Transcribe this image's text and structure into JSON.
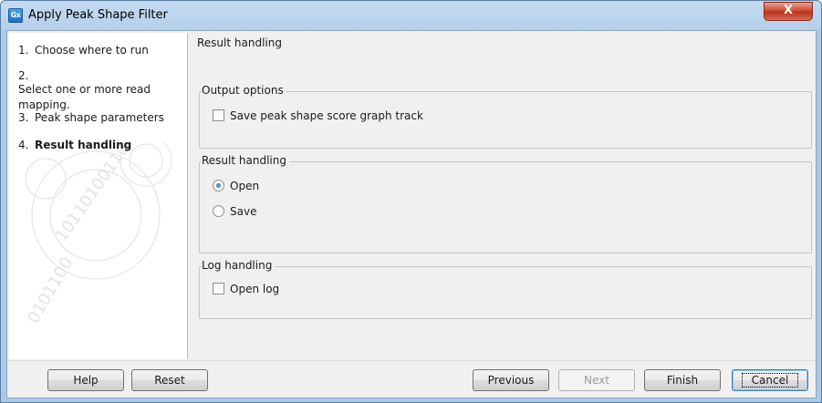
{
  "window": {
    "title": "Apply Peak Shape Filter",
    "app_icon_text": "Gx",
    "close_glyph": "X"
  },
  "steps": [
    {
      "num": "1.",
      "label": "Choose where to run",
      "active": false
    },
    {
      "num": "2.",
      "label": "Select one or more read mapping.",
      "active": false
    },
    {
      "num": "3.",
      "label": "Peak shape parameters",
      "active": false
    },
    {
      "num": "4.",
      "label": "Result handling",
      "active": true
    }
  ],
  "content": {
    "header": "Result handling",
    "output_options": {
      "title": "Output options",
      "save_graph_track": {
        "label": "Save peak shape score graph track",
        "checked": false
      }
    },
    "result_handling": {
      "title": "Result handling",
      "options": [
        {
          "label": "Open",
          "checked": true
        },
        {
          "label": "Save",
          "checked": false
        }
      ]
    },
    "log_handling": {
      "title": "Log handling",
      "open_log": {
        "label": "Open log",
        "checked": false
      }
    }
  },
  "buttons": {
    "help": "Help",
    "reset": "Reset",
    "previous": "Previous",
    "next": "Next",
    "finish": "Finish",
    "cancel": "Cancel"
  },
  "colors": {
    "window_frame": "#aec9e6",
    "close_button": "#c9452f",
    "dialog_bg": "#f0f0f0"
  }
}
